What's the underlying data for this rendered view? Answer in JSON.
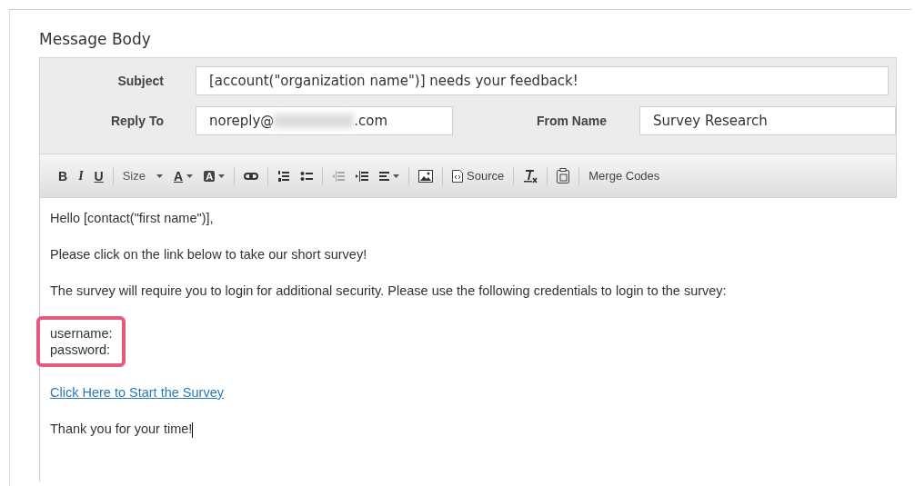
{
  "section_title": "Message Body",
  "subject": {
    "label": "Subject",
    "value": "[account(\"organization name\")] needs your feedback!"
  },
  "reply_to": {
    "label": "Reply To",
    "value_start": "noreply@",
    "value_end": ".com",
    "redacted": true
  },
  "from_name": {
    "label": "From Name",
    "value": "Survey Research"
  },
  "toolbar": [
    [
      {
        "kind": "bold",
        "label": "B"
      },
      {
        "kind": "italic",
        "label": "I"
      },
      {
        "kind": "underline",
        "label": "U"
      }
    ],
    [
      {
        "kind": "dropdown",
        "label": "Size"
      },
      {
        "kind": "text-color",
        "label": "A"
      },
      {
        "kind": "bg-color",
        "label": "A"
      }
    ],
    [
      {
        "kind": "link"
      }
    ],
    [
      {
        "kind": "ordered-list"
      },
      {
        "kind": "bullet-list"
      }
    ],
    [
      {
        "kind": "outdent",
        "disabled": true
      },
      {
        "kind": "indent",
        "disabled": false
      },
      {
        "kind": "align"
      }
    ],
    [
      {
        "kind": "image"
      }
    ],
    [
      {
        "kind": "source",
        "label": "Source"
      }
    ],
    [
      {
        "kind": "clear-format"
      }
    ],
    [
      {
        "kind": "paste"
      }
    ],
    [
      {
        "kind": "text",
        "label": "Merge Codes"
      }
    ]
  ],
  "body": [
    {
      "kind": "text",
      "text": "Hello [contact(\"first name\")],"
    },
    {
      "kind": "text",
      "text": "Please click on the link below to take our short survey!"
    },
    {
      "kind": "text",
      "text": "The survey will require you to login for additional security. Please use the following credentials to login to the survey:"
    },
    {
      "kind": "highlight",
      "lines": [
        "username:",
        "password:"
      ]
    },
    {
      "kind": "link",
      "text": "Click Here to Start the Survey"
    },
    {
      "kind": "text",
      "text": "Thank you for your time!",
      "cursor": true
    }
  ]
}
